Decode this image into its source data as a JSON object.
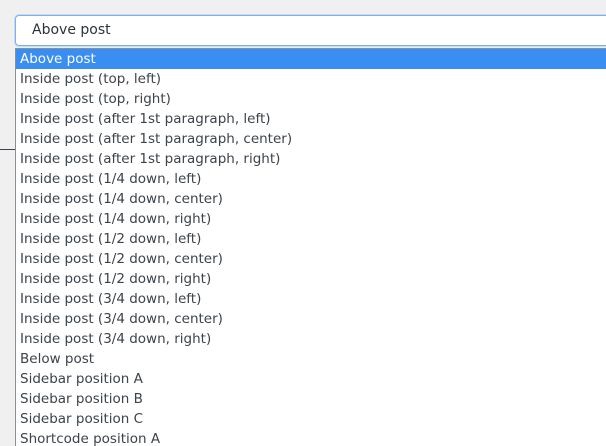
{
  "select": {
    "current_value": "Above post"
  },
  "dropdown": {
    "options": [
      "Above post",
      "Inside post (top, left)",
      "Inside post (top, right)",
      "Inside post (after 1st paragraph, left)",
      "Inside post (after 1st paragraph, center)",
      "Inside post (after 1st paragraph, right)",
      "Inside post (1/4 down, left)",
      "Inside post (1/4 down, center)",
      "Inside post (1/4 down, right)",
      "Inside post (1/2 down, left)",
      "Inside post (1/2 down, center)",
      "Inside post (1/2 down, right)",
      "Inside post (3/4 down, left)",
      "Inside post (3/4 down, center)",
      "Inside post (3/4 down, right)",
      "Below post",
      "Sidebar position A",
      "Sidebar position B",
      "Sidebar position C",
      "Shortcode position A"
    ],
    "selected_index": 0
  },
  "colors": {
    "highlight": "#3a8ef2",
    "focus_border": "#7fb0e8",
    "text": "#3c434a"
  }
}
